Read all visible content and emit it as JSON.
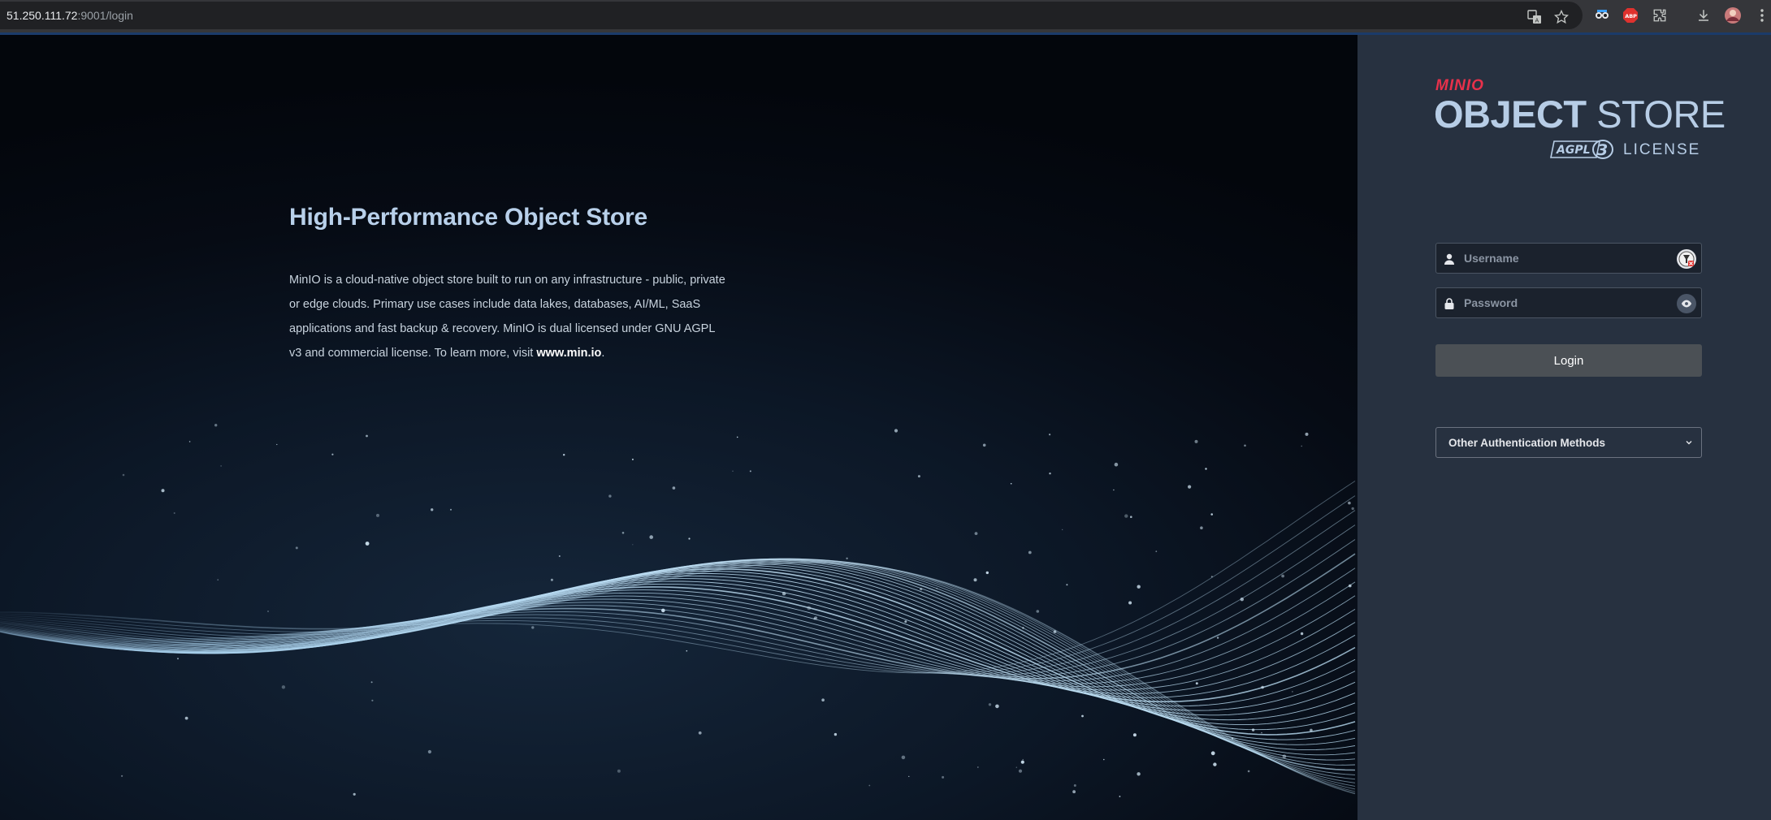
{
  "browser": {
    "url_host": "51.250.111.72",
    "url_rest": ":9001/login",
    "icons": [
      "translate-icon",
      "bookmark-star-icon",
      "extension-eyes-icon",
      "adblock-icon",
      "extensions-puzzle-icon",
      "download-icon",
      "profile-avatar-icon",
      "menu-kebab-icon"
    ]
  },
  "hero": {
    "title": "High-Performance Object Store",
    "description": "MinIO is a cloud-native object store built to run on any infrastructure - public, private or edge clouds. Primary use cases include data lakes, databases, AI/ML, SaaS applications and fast backup & recovery. MinIO is dual licensed under GNU AGPL v3 and commercial license. To learn more, visit",
    "link_text": "www.min.io",
    "description_end": "."
  },
  "logo": {
    "brand": "MINIO",
    "title_bold": "OBJECT",
    "title_light": " STORE",
    "agpl": "AGPL",
    "agpl_version": "3",
    "license": "LICENSE"
  },
  "form": {
    "username_placeholder": "Username",
    "password_placeholder": "Password",
    "login_label": "Login",
    "other_auth_label": "Other Authentication Methods"
  },
  "colors": {
    "panel_bg": "#273140",
    "accent_red": "#e8314b",
    "logo_blue": "#b7cde6",
    "button_bg": "#4b5055"
  }
}
